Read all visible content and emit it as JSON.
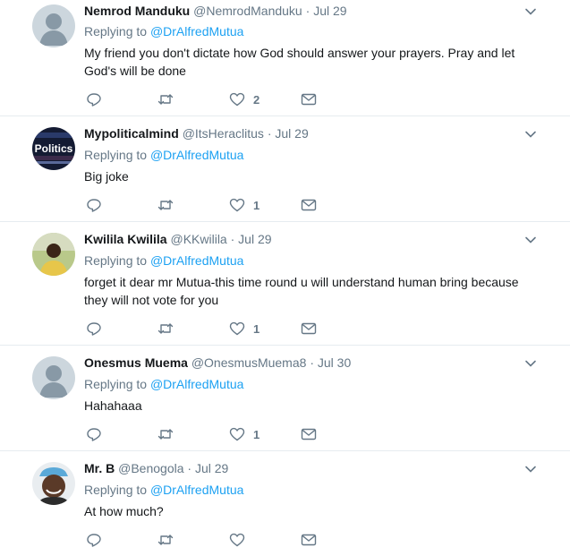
{
  "tweets": [
    {
      "name": "Nemrod Manduku",
      "handle": "@NemrodManduku",
      "time": "Jul 29",
      "replying_prefix": "Replying to",
      "replying_to": "@DrAlfredMutua",
      "text_lines": [
        "My friend you don't dictate how God should answer your prayers. Pray and let",
        "God's will be done"
      ],
      "likes": "2",
      "avatar": "default-egg-avatar"
    },
    {
      "name": "Mypoliticalmind",
      "handle": "@ItsHeraclitus",
      "time": "Jul 29",
      "replying_prefix": "Replying to",
      "replying_to": "@DrAlfredMutua",
      "text_lines": [
        "Big joke"
      ],
      "likes": "1",
      "avatar": "politics-avatar",
      "avatar_text": "Politics"
    },
    {
      "name": "Kwilila Kwilila",
      "handle": "@KKwilila",
      "time": "Jul 29",
      "replying_prefix": "Replying to",
      "replying_to": "@DrAlfredMutua",
      "text_lines": [
        "forget it dear mr Mutua-this time round u will understand human bring because",
        "they will not vote for you"
      ],
      "likes": "1",
      "avatar": "photo-avatar"
    },
    {
      "name": "Onesmus Muema",
      "handle": "@OnesmusMuema8",
      "time": "Jul 30",
      "replying_prefix": "Replying to",
      "replying_to": "@DrAlfredMutua",
      "text_lines": [
        "Hahahaaa"
      ],
      "likes": "1",
      "avatar": "default-egg-avatar"
    },
    {
      "name": "Mr. B",
      "handle": "@Benogola",
      "time": "Jul 29",
      "replying_prefix": "Replying to",
      "replying_to": "@DrAlfredMutua",
      "text_lines": [
        "At how much?"
      ],
      "likes": "",
      "avatar": "photo-avatar"
    }
  ],
  "separator": "·",
  "colors": {
    "accent": "#1da1f2",
    "muted": "#657786",
    "text": "#14171a",
    "divider": "#e6ecf0",
    "icon": "#657786"
  }
}
